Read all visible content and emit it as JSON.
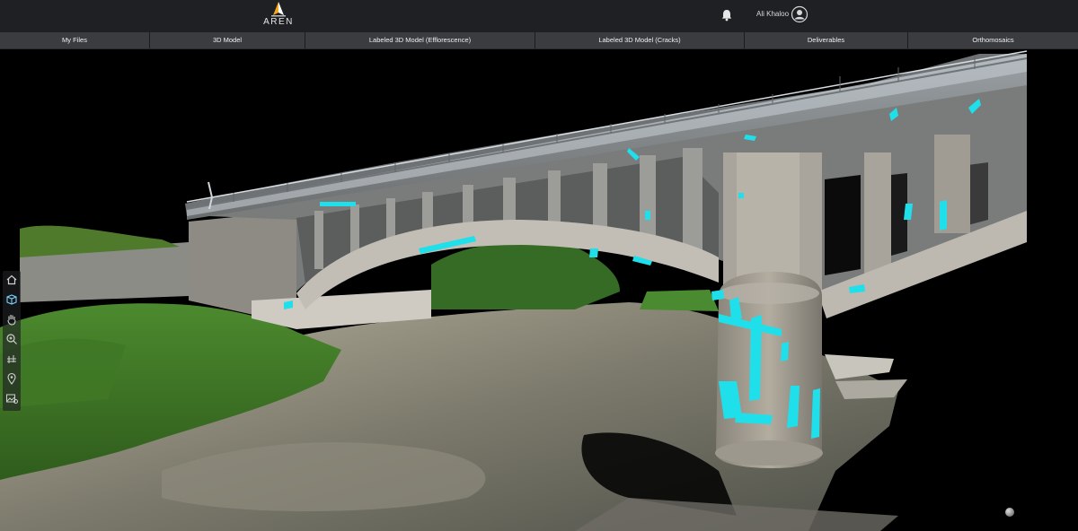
{
  "header": {
    "logo_text": "AREN",
    "user_name": "Ali Khaloo",
    "bell_icon": "bell-icon",
    "avatar_icon": "user-avatar-icon"
  },
  "nav": {
    "tabs": [
      {
        "label": "My Files"
      },
      {
        "label": "3D Model"
      },
      {
        "label": "Labeled 3D Model (Efflorescence)"
      },
      {
        "label": "Labeled 3D Model (Cracks)"
      },
      {
        "label": "Deliverables"
      },
      {
        "label": "Orthomosaics"
      }
    ]
  },
  "viewer": {
    "label_color": "#1fe0ea",
    "tools": [
      "home-icon",
      "cube-view-icon",
      "pan-hand-icon",
      "zoom-icon",
      "measure-icon",
      "location-pin-icon",
      "image-pin-icon"
    ]
  }
}
